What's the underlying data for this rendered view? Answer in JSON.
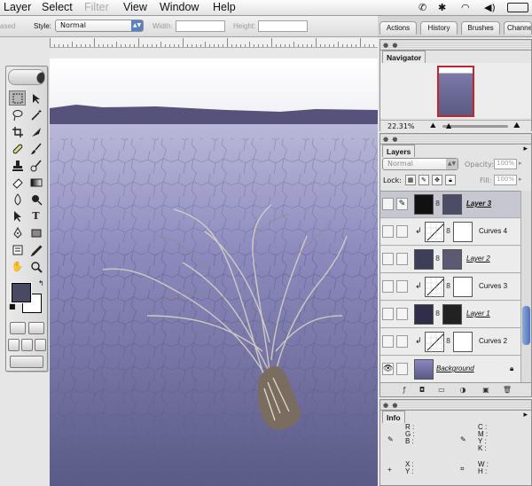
{
  "menubar": {
    "items": [
      "Layer",
      "Select",
      "Filter",
      "View",
      "Window",
      "Help"
    ]
  },
  "options": {
    "mode_fragment": "ased",
    "style_label": "Style:",
    "style_value": "Normal",
    "width_label": "Width:",
    "height_label": "Height:"
  },
  "palette_well": {
    "tabs": [
      "Actions",
      "History",
      "Brushes",
      "Channe"
    ]
  },
  "navigator": {
    "title": "Navigator",
    "zoom": "22.31%"
  },
  "layers": {
    "title": "Layers",
    "blend_mode": "Normal",
    "opacity_label": "Opacity:",
    "opacity_value": "100%",
    "lock_label": "Lock:",
    "fill_label": "Fill:",
    "fill_value": "100%",
    "rows": [
      {
        "name": "Layer 3"
      },
      {
        "name": "Curves 4"
      },
      {
        "name": "Layer 2"
      },
      {
        "name": "Curves 3"
      },
      {
        "name": "Layer 1"
      },
      {
        "name": "Curves 2"
      },
      {
        "name": "Background"
      }
    ]
  },
  "info": {
    "title": "Info",
    "rgb": [
      "R :",
      "G :",
      "B :"
    ],
    "cmyk": [
      "C :",
      "M :",
      "Y :",
      "K :"
    ],
    "xy": [
      "X :",
      "Y :"
    ],
    "wh": [
      "W :",
      "H :"
    ]
  },
  "colors": {
    "foreground": "#4a4964",
    "background": "#ffffff",
    "selected_layer": "#c7c7d2"
  },
  "icons": [
    "apple-menu-icon",
    "wireless-icon",
    "volume-icon",
    "battery-icon",
    "marquee-icon",
    "move-icon",
    "lasso-icon",
    "magic-wand-icon",
    "crop-icon",
    "slice-icon",
    "healing-icon",
    "brush-icon",
    "stamp-icon",
    "history-brush-icon",
    "eraser-icon",
    "gradient-icon",
    "blur-icon",
    "dodge-icon",
    "path-select-icon",
    "type-icon",
    "pen-icon",
    "shape-icon",
    "notes-icon",
    "eyedropper-icon",
    "hand-icon",
    "zoom-icon"
  ]
}
